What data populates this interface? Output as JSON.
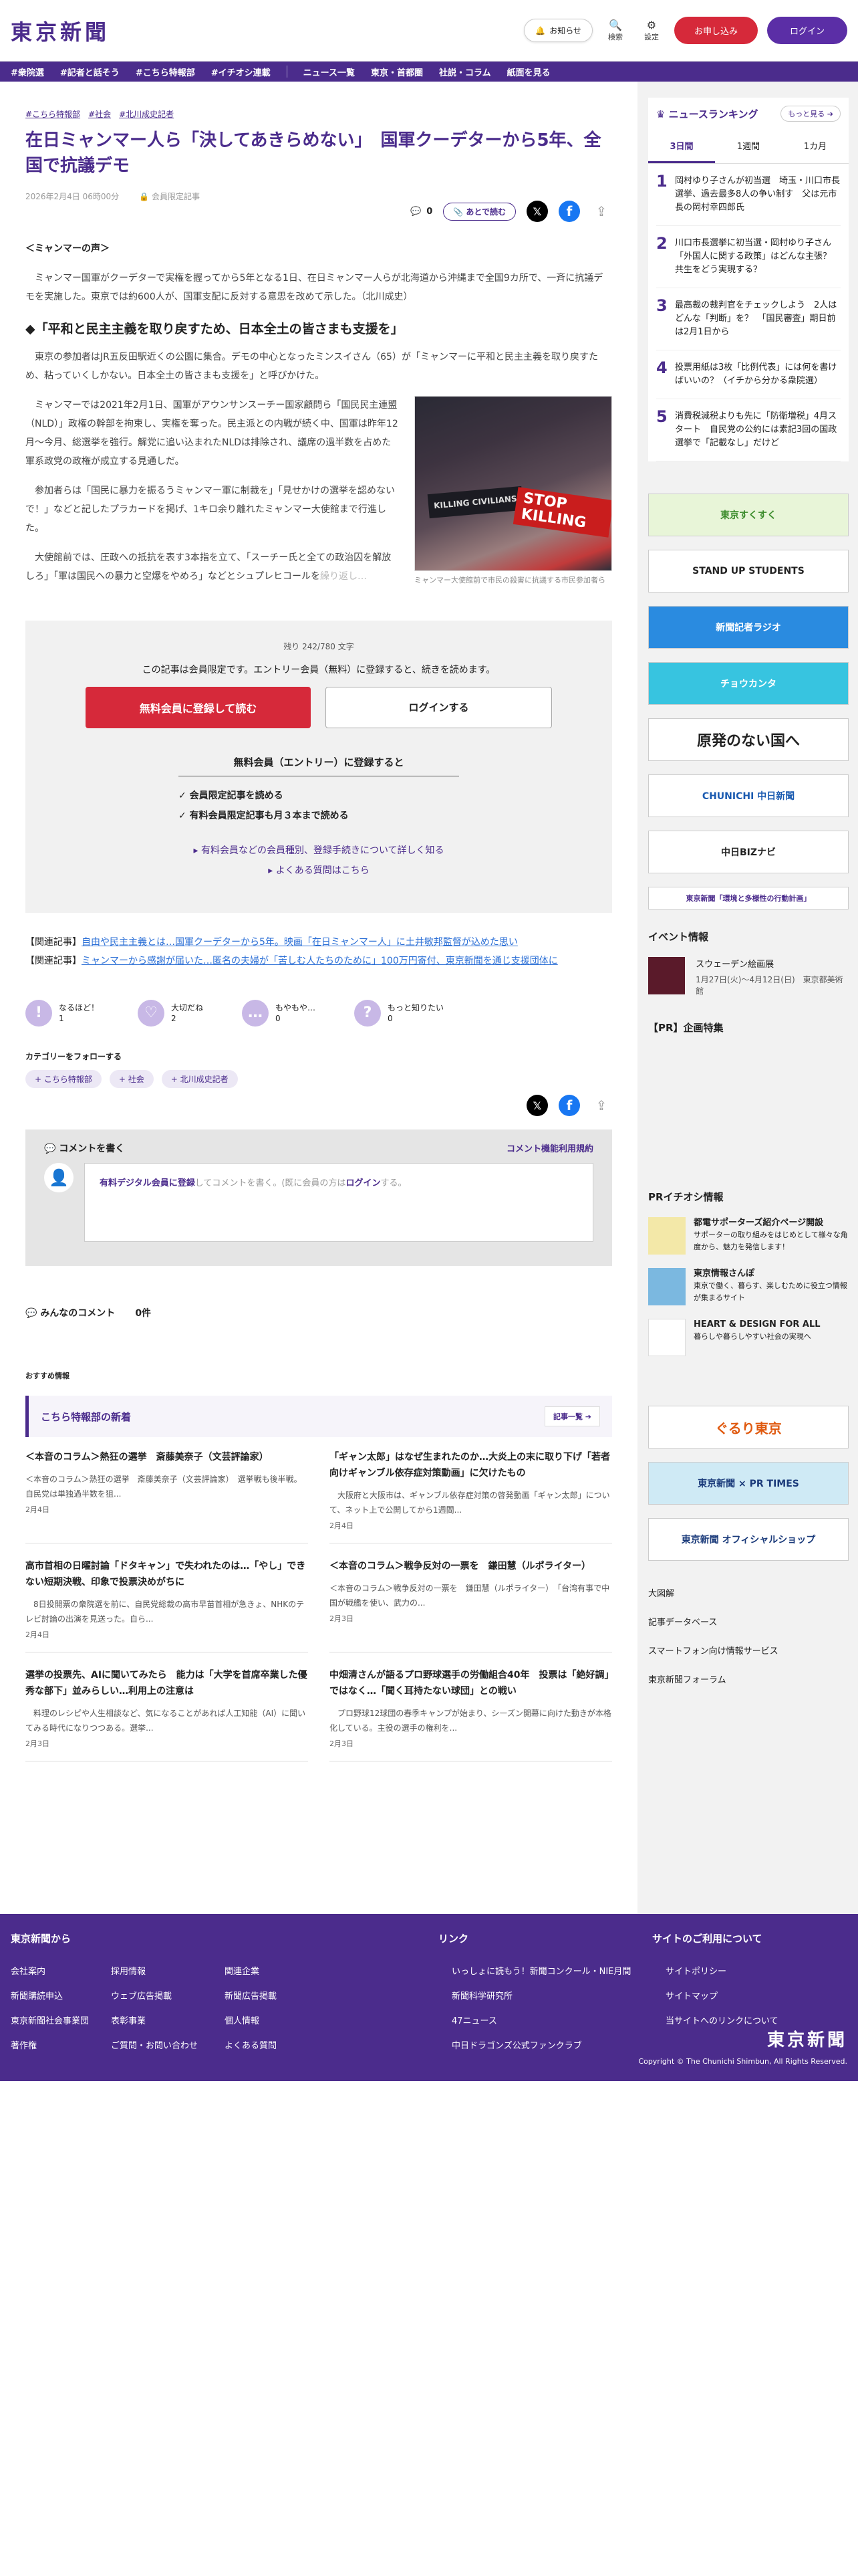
{
  "header": {
    "logo": "東京新聞",
    "notice": "お知らせ",
    "search": "検索",
    "settings": "設定",
    "subscribe": "お申し込み",
    "login": "ログイン"
  },
  "nav": [
    "#衆院選",
    "#記者と話そう",
    "#こちら特報部",
    "#イチオシ連載",
    "ニュース一覧",
    "東京・首都圏",
    "社説・コラム",
    "紙面を見る"
  ],
  "article": {
    "tags": [
      "#こちら特報部",
      "#社会",
      "#北川成史記者"
    ],
    "title": "在日ミャンマー人ら「決してあきらめない」　国軍クーデターから5年、全国で抗議デモ",
    "date": "2026年2月4日 06時00分",
    "members_only": "会員限定記事",
    "comment_count": "0",
    "read_later": "あとで読む",
    "lead_title": "＜ミャンマーの声＞",
    "lead": "　ミャンマー国軍がクーデターで実権を握ってから5年となる1日、在日ミャンマー人らが北海道から沖縄まで全国9カ所で、一斉に抗議デモを実施した。東京では約600人が、国軍支配に反対する意思を改めて示した。（北川成史）",
    "h2": "◆「平和と民主主義を取り戻すため、日本全土の皆さまも支援を」",
    "p1": "　東京の参加者はJR五反田駅近くの公園に集合。デモの中心となったミンスイさん（65）が「ミャンマーに平和と民主主義を取り戻すため、粘っていくしかない。日本全土の皆さまも支援を」と呼びかけた。",
    "p2": "　ミャンマーでは2021年2月1日、国軍がアウンサンスーチー国家顧問ら「国民民主連盟（NLD）」政権の幹部を拘束し、実権を奪った。民主派との内戦が続く中、国軍は昨年12月〜今月、総選挙を強行。解党に追い込まれたNLDは排除され、議席の過半数を占めた軍系政党の政権が成立する見通しだ。",
    "p3": "　参加者らは「国民に暴力を振るうミャンマー軍に制裁を」「見せかけの選挙を認めないで！」などと記したプラカードを掲げ、1キロ余り離れたミャンマー大使館まで行進した。",
    "p4": "　大使館前では、圧政への抵抗を表す3本指を立て、「スーチー氏と全ての政治囚を解放しろ」「軍は国民への暴力と空爆をやめろ」などとシュプレヒコールを",
    "p4b": "繰り返し…",
    "fig_caption": "ミャンマー大使館前で市民の殺害に抗議する市民参加者ら",
    "fig_sign1": "STOP KILLING",
    "fig_sign2": "KILLING CIVILIANS"
  },
  "paywall": {
    "remaining": "残り 242/780 文字",
    "message": "この記事は会員限定です。エントリー会員（無料）に登録すると、続きを読めます。",
    "register": "無料会員に登録して読む",
    "login": "ログインする",
    "sub_title": "無料会員（エントリー）に登録すると",
    "benefit1": "✓  会員限定記事を読める",
    "benefit2": "✓  有料会員限定記事も月３本まで読める",
    "link1": "▸ 有料会員などの会員種別、登録手続きについて詳しく知る",
    "link2": "▸ よくある質問はこちら"
  },
  "related": [
    {
      "prefix": "【関連記事】",
      "text": "自由や民主主義とは…国軍クーデターから5年。映画「在日ミャンマー人」に土井敏邦監督が込めた思い"
    },
    {
      "prefix": "【関連記事】",
      "text": "ミャンマーから感謝が届いた…匿名の夫婦が「苦しむ人たちのために」100万円寄付、東京新聞を通じ支援団体に"
    }
  ],
  "reactions": [
    {
      "label": "なるほど！",
      "count": "1",
      "icon": "!"
    },
    {
      "label": "大切だね",
      "count": "2",
      "icon": "♡"
    },
    {
      "label": "もやもや…",
      "count": "0",
      "icon": "…"
    },
    {
      "label": "もっと知りたい",
      "count": "0",
      "icon": "?"
    }
  ],
  "follow": {
    "title": "カテゴリーをフォローする",
    "items": [
      "+ こちら特報部",
      "+ 社会",
      "+ 北川成史記者"
    ]
  },
  "comments": {
    "write": "コメントを書く",
    "terms": "コメント機能利用規約",
    "prompt_link": "有料デジタル会員に登録",
    "prompt_mid": "してコメントを書く。(既に会員の方は",
    "prompt_login": "ログイン",
    "prompt_end": "する。",
    "all": "みんなのコメント",
    "all_count": "0件"
  },
  "osusume": "おすすめ情報",
  "tokuho": {
    "title": "こちら特報部の新着",
    "more": "記事一覧 ➔"
  },
  "cards": [
    {
      "title": "＜本音のコラム＞熱狂の選挙　斎藤美奈子（文芸評論家）",
      "desc": "＜本音のコラム＞熱狂の選挙　斎藤美奈子（文芸評論家）　選挙戦も後半戦。自民党は単独過半数を狙...",
      "date": "2月4日"
    },
    {
      "title": "「ギャン太郎」はなぜ生まれたのか…大炎上の末に取り下げ「若者向けギャンブル依存症対策動画」に欠けたもの",
      "desc": "　大阪府と大阪市は、ギャンブル依存症対策の啓発動画「ギャン太郎」について、ネット上で公開してから1週間...",
      "date": "2月4日"
    },
    {
      "title": "高市首相の日曜討論「ドタキャン」で失われたのは…「やし」できない短期決戦、印象で投票決めがちに",
      "desc": "　8日投開票の衆院選を前に、自民党総裁の高市早苗首相が急きょ、NHKのテレビ討論の出演を見送った。自ら...",
      "date": "2月4日"
    },
    {
      "title": "＜本音のコラム＞戦争反対の一票を　鎌田慧（ルポライター）",
      "desc": "＜本音のコラム＞戦争反対の一票を　鎌田慧（ルポライター）　「台湾有事で中国が戦艦を使い、武力の...",
      "date": "2月3日"
    },
    {
      "title": "選挙の投票先、AIに聞いてみたら　能力は「大学を首席卒業した優秀な部下」並みらしい…利用上の注意は",
      "desc": "　料理のレシピや人生相談など、気になることがあれば人工知能（AI）に聞いてみる時代になりつつある。選挙...",
      "date": "2月3日"
    },
    {
      "title": "中畑清さんが語るプロ野球選手の労働組合40年　投票は「絶好調」ではなく…「聞く耳持たない球団」との戦い",
      "desc": "　プロ野球12球団の春季キャンプが始まり、シーズン開幕に向けた動きが本格化している。主役の選手の権利を...",
      "date": "2月3日"
    }
  ],
  "sidebar": {
    "ranking_title": "ニュースランキング",
    "ranking_more": "もっと見る ➔",
    "tabs": [
      "3日間",
      "1週間",
      "1カ月"
    ],
    "ranking": [
      {
        "n": "1",
        "t": "岡村ゆり子さんが初当選　埼玉・川口市長選挙、過去最多8人の争い制す　父は元市長の岡村幸四郎氏"
      },
      {
        "n": "2",
        "t": "川口市長選挙に初当選・岡村ゆり子さん「外国人に関する政策」はどんな主張？　共生をどう実現する？"
      },
      {
        "n": "3",
        "t": "最高裁の裁判官をチェックしよう　2人はどんな「判断」を？　「国民審査」期日前は2月1日から"
      },
      {
        "n": "4",
        "t": "投票用紙は3枚「比例代表」には何を書けばいいの？（イチから分かる衆院選）"
      },
      {
        "n": "5",
        "t": "消費税減税よりも先に「防衛増税」4月スタート　自民党の公約には素記3回の国政選挙で「記載なし」だけど"
      }
    ],
    "banners": [
      "東京すくすく",
      "STAND UP STUDENTS",
      "新聞記者ラジオ",
      "チョウカンタ",
      "原発のない国へ",
      "CHUNICHI 中日新聞",
      "中日BIZナビ",
      "東京新聞「環境と多様性の行動計画」"
    ],
    "event_title": "イベント情報",
    "event": {
      "name": "スウェーデン絵画展",
      "detail": "1月27日(火)〜4月12日(日)　東京都美術館"
    },
    "pr_title": "【PR】企画特集",
    "pr2_title": "PRイチオシ情報",
    "pr_items": [
      {
        "title": "都電サポーターズ紹介ページ開設",
        "desc": "サポーターの取り組みをはじめとして様々な角度から、魅力を発信します！"
      },
      {
        "title": "東京情報さんぽ",
        "desc": "東京で働く、暮らす、楽しむために役立つ情報が集まるサイト"
      },
      {
        "title": "HEART & DESIGN FOR ALL",
        "desc": "暮らしや暮らしやすい社会の実現へ"
      }
    ],
    "banners2": [
      "ぐるり東京",
      "東京新聞 × PR TIMES",
      "東京新聞 オフィシャルショップ"
    ],
    "links": [
      "大図解",
      "記事データベース",
      "スマートフォン向け情報サービス",
      "東京新聞フォーラム"
    ]
  },
  "footer": {
    "from": "東京新聞から",
    "link": "リンク",
    "site": "サイトのご利用について",
    "col1": [
      "会社案内",
      "新聞購読申込",
      "東京新聞社会事業団",
      "著作権"
    ],
    "col2": [
      "採用情報",
      "ウェブ広告掲載",
      "表彰事業",
      "ご質問・お問い合わせ"
    ],
    "col3": [
      "関連企業",
      "新聞広告掲載",
      "個人情報",
      "よくある質問"
    ],
    "col4": [
      "いっしょに読もう！新聞コンクール・NIE月間",
      "新聞科学研究所",
      "47ニュース",
      "中日ドラゴンズ公式ファンクラブ"
    ],
    "col5": [
      "サイトポリシー",
      "サイトマップ",
      "当サイトへのリンクについて"
    ],
    "logo": "東京新聞",
    "copyright": "Copyright © The Chunichi Shimbun, All Rights Reserved."
  }
}
